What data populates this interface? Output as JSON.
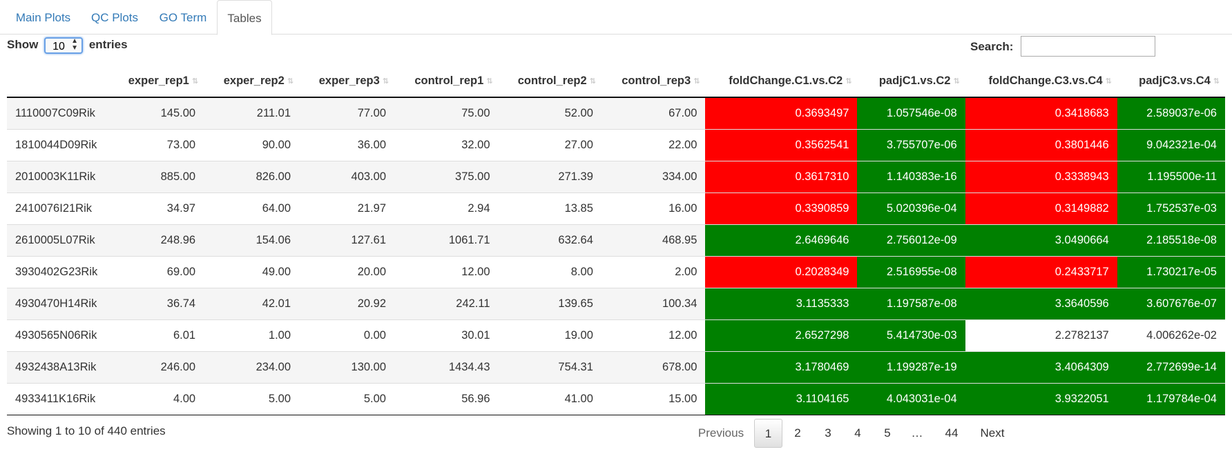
{
  "tabs": [
    "Main Plots",
    "QC Plots",
    "GO Term",
    "Tables"
  ],
  "length": {
    "show_label": "Show",
    "value": "10",
    "entries_label": "entries"
  },
  "search": {
    "label": "Search:",
    "value": ""
  },
  "table": {
    "columns": [
      "",
      "exper_rep1",
      "exper_rep2",
      "exper_rep3",
      "control_rep1",
      "control_rep2",
      "control_rep3",
      "foldChange.C1.vs.C2",
      "padjC1.vs.C2",
      "foldChange.C3.vs.C4",
      "padjC3.vs.C4"
    ],
    "rows": [
      [
        "1110007C09Rik",
        "145.00",
        "211.01",
        "77.00",
        "75.00",
        "52.00",
        "67.00",
        "0.3693497",
        "1.057546e-08",
        "0.3418683",
        "2.589037e-06"
      ],
      [
        "1810044D09Rik",
        "73.00",
        "90.00",
        "36.00",
        "32.00",
        "27.00",
        "22.00",
        "0.3562541",
        "3.755707e-06",
        "0.3801446",
        "9.042321e-04"
      ],
      [
        "2010003K11Rik",
        "885.00",
        "826.00",
        "403.00",
        "375.00",
        "271.39",
        "334.00",
        "0.3617310",
        "1.140383e-16",
        "0.3338943",
        "1.195500e-11"
      ],
      [
        "2410076I21Rik",
        "34.97",
        "64.00",
        "21.97",
        "2.94",
        "13.85",
        "16.00",
        "0.3390859",
        "5.020396e-04",
        "0.3149882",
        "1.752537e-03"
      ],
      [
        "2610005L07Rik",
        "248.96",
        "154.06",
        "127.61",
        "1061.71",
        "632.64",
        "468.95",
        "2.6469646",
        "2.756012e-09",
        "3.0490664",
        "2.185518e-08"
      ],
      [
        "3930402G23Rik",
        "69.00",
        "49.00",
        "20.00",
        "12.00",
        "8.00",
        "2.00",
        "0.2028349",
        "2.516955e-08",
        "0.2433717",
        "1.730217e-05"
      ],
      [
        "4930470H14Rik",
        "36.74",
        "42.01",
        "20.92",
        "242.11",
        "139.65",
        "100.34",
        "3.1135333",
        "1.197587e-08",
        "3.3640596",
        "3.607676e-07"
      ],
      [
        "4930565N06Rik",
        "6.01",
        "1.00",
        "0.00",
        "30.01",
        "19.00",
        "12.00",
        "2.6527298",
        "5.414730e-03",
        "2.2782137",
        "4.006262e-02"
      ],
      [
        "4932438A13Rik",
        "246.00",
        "234.00",
        "130.00",
        "1434.43",
        "754.31",
        "678.00",
        "3.1780469",
        "1.199287e-19",
        "3.4064309",
        "2.772699e-14"
      ],
      [
        "4933411K16Rik",
        "4.00",
        "5.00",
        "5.00",
        "56.96",
        "41.00",
        "15.00",
        "3.1104165",
        "4.043031e-04",
        "3.9322051",
        "1.179784e-04"
      ]
    ],
    "highlight": [
      [
        "red",
        "green",
        "red",
        "green"
      ],
      [
        "red",
        "green",
        "red",
        "green"
      ],
      [
        "red",
        "green",
        "red",
        "green"
      ],
      [
        "red",
        "green",
        "red",
        "green"
      ],
      [
        "green",
        "green",
        "green",
        "green"
      ],
      [
        "red",
        "green",
        "red",
        "green"
      ],
      [
        "green",
        "green",
        "green",
        "green"
      ],
      [
        "green",
        "green",
        "",
        ""
      ],
      [
        "green",
        "green",
        "green",
        "green"
      ],
      [
        "green",
        "green",
        "green",
        "green"
      ]
    ],
    "colors": {
      "red": "#ff0000",
      "green": "#008000"
    }
  },
  "info": "Showing 1 to 10 of 440 entries",
  "pagination": {
    "previous": "Previous",
    "pages": [
      "1",
      "2",
      "3",
      "4",
      "5",
      "…",
      "44"
    ],
    "current": "1",
    "next": "Next"
  }
}
